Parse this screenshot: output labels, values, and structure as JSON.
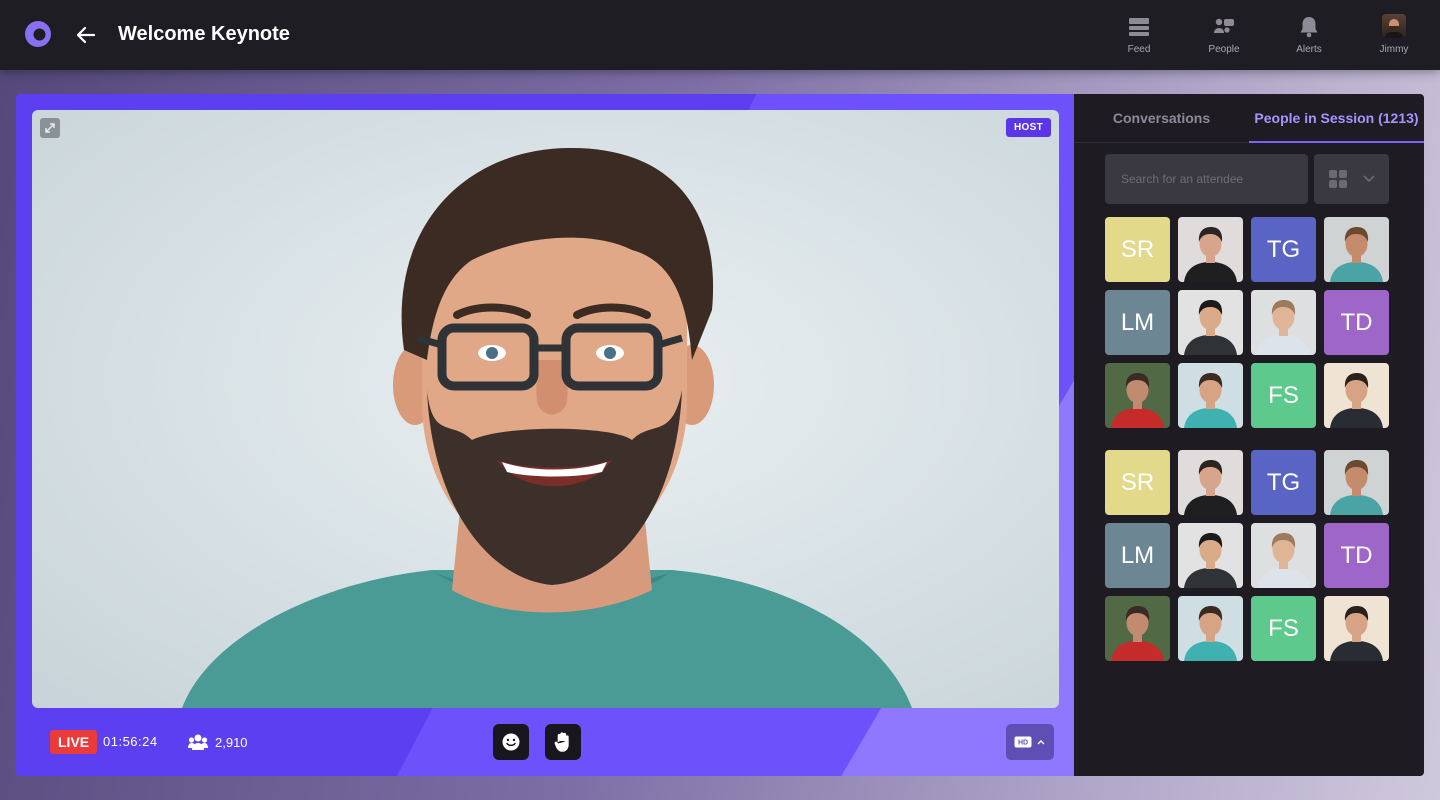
{
  "header": {
    "title": "Welcome Keynote",
    "nav": [
      {
        "label": "Feed",
        "icon": "feed-icon"
      },
      {
        "label": "People",
        "icon": "people-icon"
      },
      {
        "label": "Alerts",
        "icon": "bell-icon"
      },
      {
        "label": "Jimmy",
        "icon": "user-avatar"
      }
    ]
  },
  "stage": {
    "host_label": "HOST",
    "live_label": "LIVE",
    "timer": "01:56:24",
    "viewer_count": "2,910",
    "quality_label": "HD"
  },
  "sidebar": {
    "tabs": [
      {
        "label": "Conversations",
        "active": false
      },
      {
        "label": "People in Session (1213)",
        "active": true
      }
    ],
    "search_placeholder": "Search for an attendee",
    "attendees": [
      {
        "type": "initials",
        "text": "SR",
        "color": "#e3d98b"
      },
      {
        "type": "photo",
        "bg": "#e0dcdc",
        "skin": "#d7a58c",
        "hair": "#2b2422",
        "shirt": "#1f1f22"
      },
      {
        "type": "initials",
        "text": "TG",
        "color": "#5a64c4"
      },
      {
        "type": "photo",
        "bg": "#cfd3d4",
        "skin": "#c48b6c",
        "hair": "#6b4a30",
        "shirt": "#4aa3a4"
      },
      {
        "type": "initials",
        "text": "LM",
        "color": "#6d8694"
      },
      {
        "type": "photo",
        "bg": "#e2e2e2",
        "skin": "#d9ab88",
        "hair": "#1c1a1a",
        "shirt": "#2f3336"
      },
      {
        "type": "photo",
        "bg": "#dedfe1",
        "skin": "#e0b597",
        "hair": "#9b7b5c",
        "shirt": "#dde3ea"
      },
      {
        "type": "initials",
        "text": "TD",
        "color": "#9e66c9"
      },
      {
        "type": "photo",
        "bg": "#516a45",
        "skin": "#c28a6f",
        "hair": "#3a2c25",
        "shirt": "#c62b2b"
      },
      {
        "type": "photo",
        "bg": "#cfdee3",
        "skin": "#d6a384",
        "hair": "#3a2a20",
        "shirt": "#3fb1b1"
      },
      {
        "type": "initials",
        "text": "FS",
        "color": "#5dc98c"
      },
      {
        "type": "photo",
        "bg": "#efe4d4",
        "skin": "#d6a384",
        "hair": "#2a211c",
        "shirt": "#2a2c33"
      },
      {
        "type": "initials",
        "text": "SR",
        "color": "#e3d98b"
      },
      {
        "type": "photo",
        "bg": "#e0dcdc",
        "skin": "#d7a58c",
        "hair": "#2b2422",
        "shirt": "#1f1f22"
      },
      {
        "type": "initials",
        "text": "TG",
        "color": "#5a64c4"
      },
      {
        "type": "photo",
        "bg": "#cfd3d4",
        "skin": "#c48b6c",
        "hair": "#6b4a30",
        "shirt": "#4aa3a4"
      },
      {
        "type": "initials",
        "text": "LM",
        "color": "#6d8694"
      },
      {
        "type": "photo",
        "bg": "#e2e2e2",
        "skin": "#d9ab88",
        "hair": "#1c1a1a",
        "shirt": "#2f3336"
      },
      {
        "type": "photo",
        "bg": "#dedfe1",
        "skin": "#e0b597",
        "hair": "#9b7b5c",
        "shirt": "#dde3ea"
      },
      {
        "type": "initials",
        "text": "TD",
        "color": "#9e66c9"
      },
      {
        "type": "photo",
        "bg": "#516a45",
        "skin": "#c28a6f",
        "hair": "#3a2c25",
        "shirt": "#c62b2b"
      },
      {
        "type": "photo",
        "bg": "#cfdee3",
        "skin": "#d6a384",
        "hair": "#3a2a20",
        "shirt": "#3fb1b1"
      },
      {
        "type": "initials",
        "text": "FS",
        "color": "#5dc98c"
      },
      {
        "type": "photo",
        "bg": "#efe4d4",
        "skin": "#d6a384",
        "hair": "#2a211c",
        "shirt": "#2a2c33"
      }
    ]
  },
  "colors": {
    "accent": "#6d52fb",
    "live": "#ea3b3b",
    "active_tab": "#a794ff"
  }
}
